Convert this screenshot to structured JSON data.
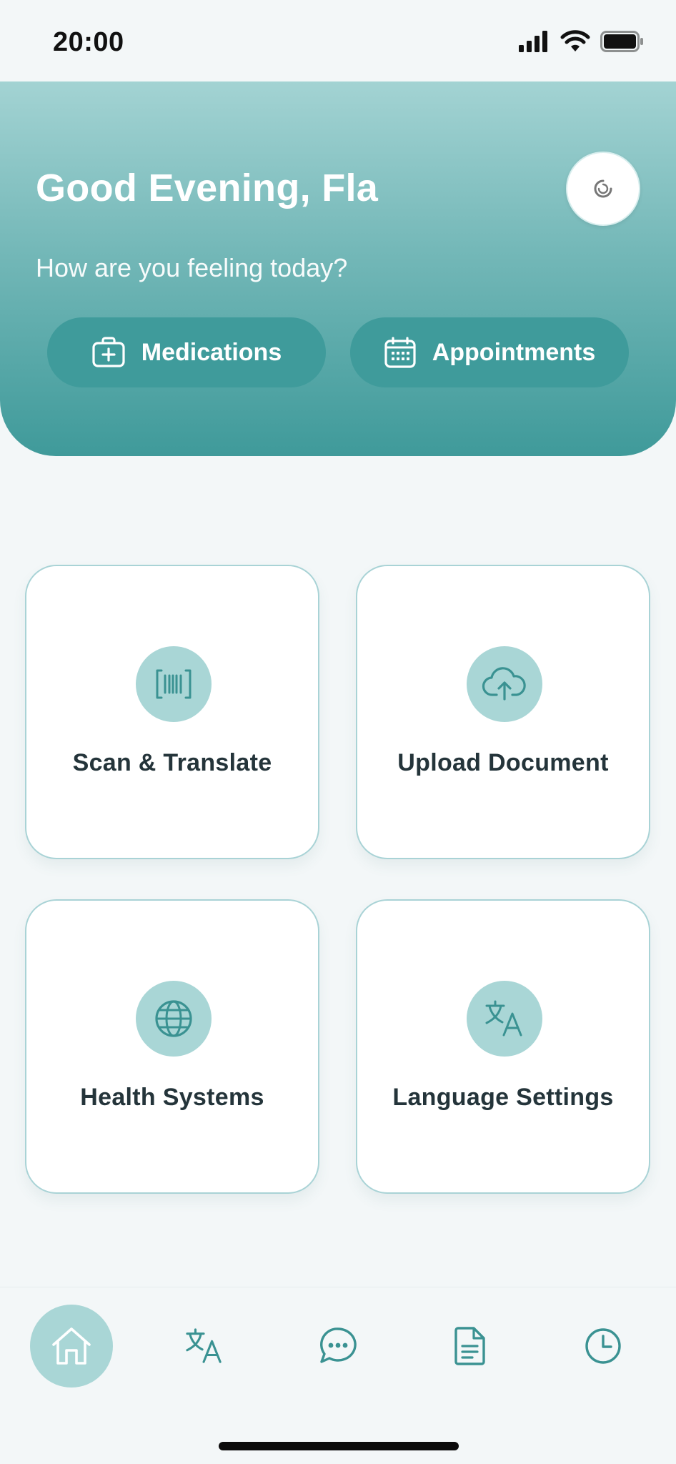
{
  "status_bar": {
    "time": "20:00"
  },
  "header": {
    "greeting": "Good Evening, Fla",
    "subtitle": "How are you feeling today?",
    "quick_actions": [
      {
        "label": "Medications",
        "icon": "medical-kit-icon"
      },
      {
        "label": "Appointments",
        "icon": "calendar-icon"
      }
    ],
    "avatar_icon": "loading-spinner-icon"
  },
  "cards": [
    {
      "label": "Scan & Translate",
      "icon": "barcode-scan-icon"
    },
    {
      "label": "Upload Document",
      "icon": "cloud-upload-icon"
    },
    {
      "label": "Health Systems",
      "icon": "globe-icon"
    },
    {
      "label": "Language Settings",
      "icon": "translate-icon"
    }
  ],
  "tab_bar": {
    "tabs": [
      {
        "icon": "home-icon",
        "active": true
      },
      {
        "icon": "translate-icon",
        "active": false
      },
      {
        "icon": "chat-icon",
        "active": false
      },
      {
        "icon": "document-icon",
        "active": false
      },
      {
        "icon": "clock-icon",
        "active": false
      }
    ]
  },
  "colors": {
    "accent": "#3f9b9b",
    "accent_light": "#a9d6d6",
    "header_top": "#a3d3d3",
    "header_bottom": "#3f9a9a",
    "card_border": "#a9d3d6",
    "text_dark": "#24343a",
    "background": "#f3f7f8"
  }
}
